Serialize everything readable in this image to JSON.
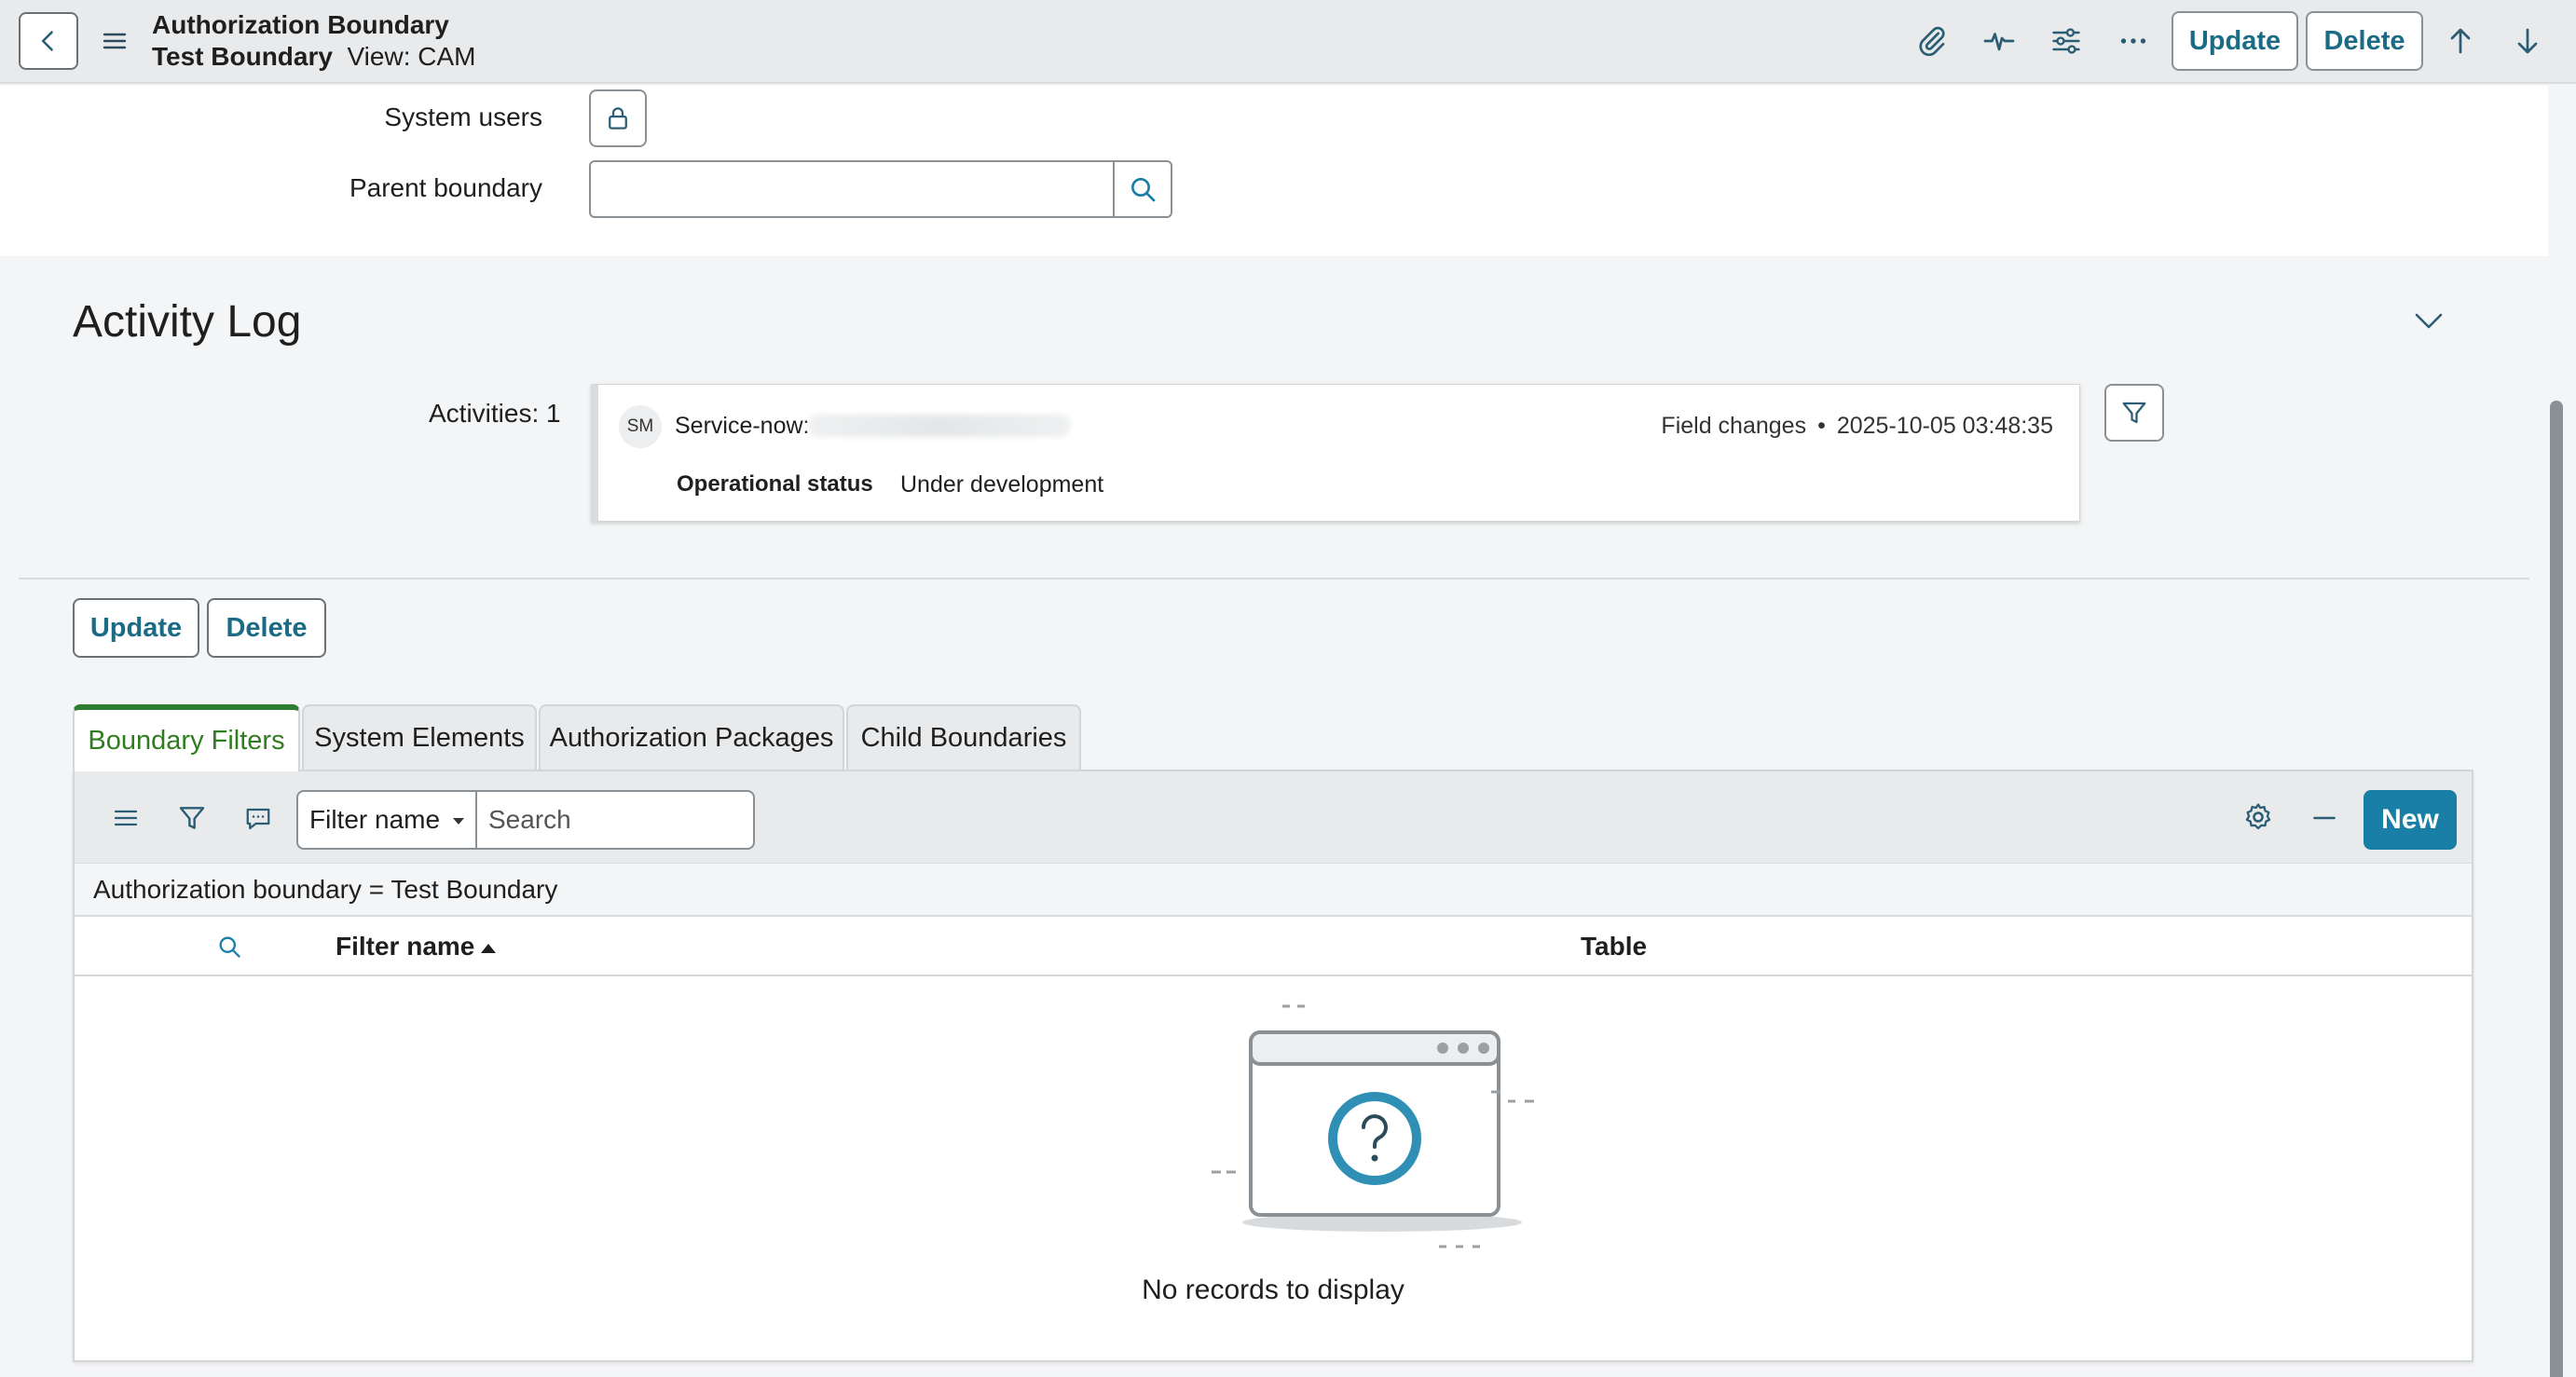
{
  "header": {
    "title": "Authorization Boundary",
    "record_name": "Test Boundary",
    "view_label": "View: CAM",
    "update_label": "Update",
    "delete_label": "Delete"
  },
  "form": {
    "system_users_label": "System users",
    "parent_boundary_label": "Parent boundary",
    "parent_boundary_value": ""
  },
  "activity_log": {
    "title": "Activity Log",
    "activities_label": "Activities: 1",
    "entry": {
      "avatar_initials": "SM",
      "author_prefix": "Service-now:",
      "change_type": "Field changes",
      "bullet": "•",
      "timestamp": "2025-10-05 03:48:35",
      "field_name": "Operational status",
      "field_value": "Under development"
    }
  },
  "actions": {
    "update_label": "Update",
    "delete_label": "Delete"
  },
  "tabs": [
    {
      "label": "Boundary Filters",
      "active": true
    },
    {
      "label": "System Elements",
      "active": false
    },
    {
      "label": "Authorization Packages",
      "active": false
    },
    {
      "label": "Child Boundaries",
      "active": false
    }
  ],
  "list": {
    "filter_select_value": "Filter name",
    "search_placeholder": "Search",
    "new_label": "New",
    "breadcrumb": "Authorization boundary = Test Boundary",
    "columns": {
      "filter_name": "Filter name",
      "table": "Table"
    },
    "empty_message": "No records to display"
  },
  "colors": {
    "accent": "#1a7fa6",
    "active_tab": "#2e7d32",
    "button_text": "#1b6b85"
  },
  "icons": [
    "back-arrow-icon",
    "hamburger-menu-icon",
    "paperclip-icon",
    "activity-pulse-icon",
    "sliders-icon",
    "more-icon",
    "arrow-up-icon",
    "arrow-down-icon",
    "lock-icon",
    "search-icon",
    "chevron-down-icon",
    "filter-funnel-icon",
    "list-menu-icon",
    "comment-icon",
    "gear-icon",
    "minimize-icon",
    "sort-ascending-icon"
  ]
}
